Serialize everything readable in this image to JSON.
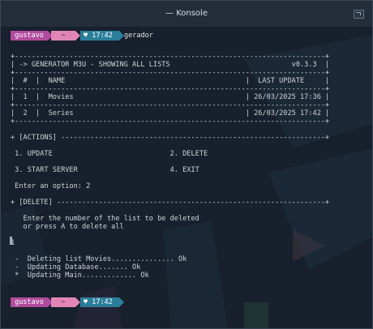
{
  "window": {
    "title": "— Konsole"
  },
  "prompt": {
    "user": "gustavo",
    "dir": "~",
    "heart": "♥",
    "time": "17:42",
    "command": "gerador"
  },
  "prompt_end": {
    "user": "gustavo",
    "dir": "~",
    "heart": "♥",
    "time": "17:42"
  },
  "terminal": {
    "lines": [
      "+--------------------------------------------------------------------------+",
      "| -> GENERATOR M3U - SHOWING ALL LISTS                             v0.3.3  |",
      "+--------------------------------------------------------------------------+",
      "|  #  |  NAME                                           |  LAST UPDATE     |",
      "+--------------------------------------------------------------------------+",
      "|  1  |  Movies                                         | 26/03/2025 17:36 |",
      "+--------------------------------------------------------------------------+",
      "|  2  |  Series                                         | 26/03/2025 17:42 |",
      "+--------------------------------------------------------------------------+",
      "",
      "+ [ACTIONS] ---------------------------------------------------------------+",
      "",
      " 1. UPDATE                            2. DELETE",
      "",
      " 3. START SERVER                      4. EXIT",
      "",
      " Enter an option: 2",
      "",
      "+ [DELETE] ----------------------------------------------------------------+",
      "",
      "   Enter the number of the list to be deleted",
      "   or press A to delete all",
      "",
      "1",
      "",
      " -  Deleting list Movies............... Ok",
      " -  Updating Database....... Ok",
      " *  Updating Main............. Ok"
    ]
  }
}
